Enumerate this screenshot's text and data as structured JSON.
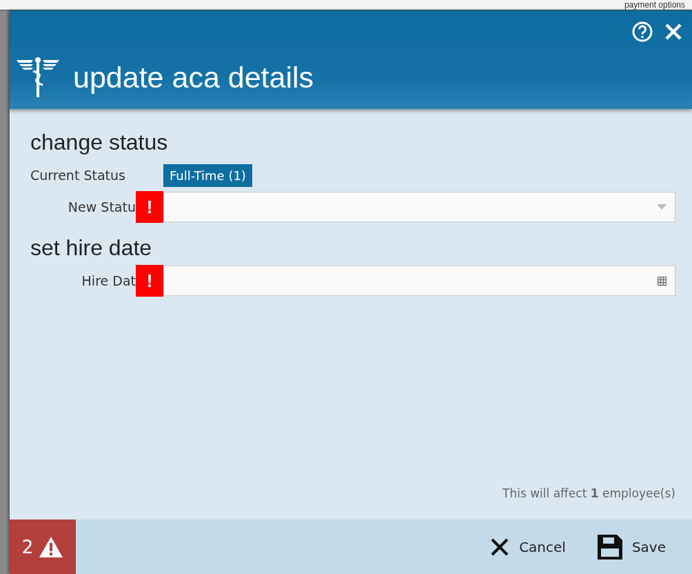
{
  "background": {
    "heading": "payment options"
  },
  "dialog": {
    "title": "update aca details",
    "sections": [
      {
        "heading": "change status",
        "rows": [
          {
            "kind": "readonly",
            "label": "Current Status",
            "value": "Full-Time (1)"
          },
          {
            "kind": "dropdown",
            "label": "New Statu",
            "error": true,
            "error_mark": "!"
          }
        ]
      },
      {
        "heading": "set hire date",
        "rows": [
          {
            "kind": "date",
            "label": "Hire Dat",
            "error": true,
            "error_mark": "!"
          }
        ]
      }
    ],
    "note": "This will affect **1** employee(s)",
    "footer": {
      "error_count": "2",
      "buttons": [
        {
          "kind": "cancel",
          "label": "Cancel"
        },
        {
          "kind": "save",
          "label": "Save"
        }
      ]
    }
  }
}
